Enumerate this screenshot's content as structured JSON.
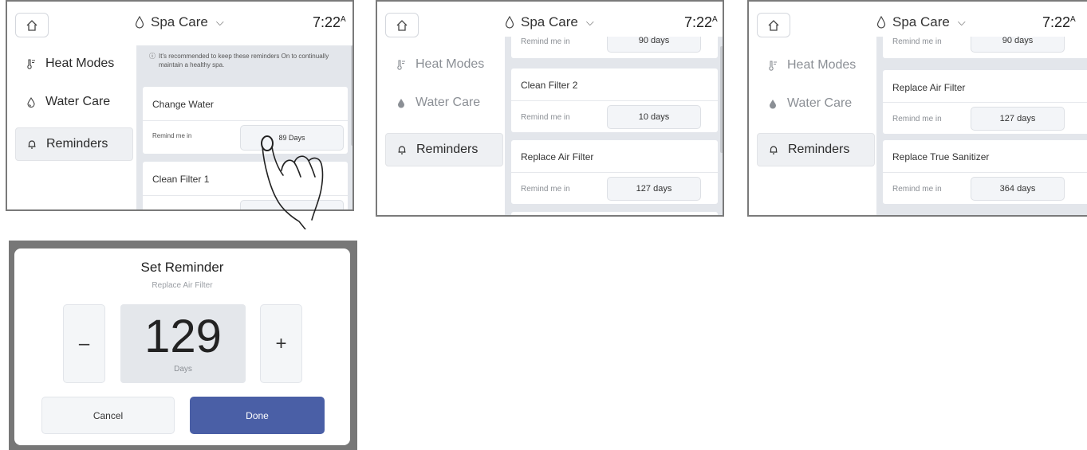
{
  "app": {
    "title": "Spa Care",
    "time": "7:22",
    "time_suffix": "A"
  },
  "nav": {
    "heat_modes": "Heat Modes",
    "water_care": "Water Care",
    "reminders": "Reminders"
  },
  "screen1": {
    "info_text": "It's recommended to keep these reminders On to continually maintain a healthy spa.",
    "cards": [
      {
        "title": "Change Water",
        "remind_label": "Remind me in",
        "value": "89 Days"
      },
      {
        "title": "Clean Filter 1"
      }
    ]
  },
  "screen2": {
    "top_remind_label": "Remind me in",
    "top_value": "90 days",
    "cards": [
      {
        "title": "Clean Filter 2",
        "remind_label": "Remind me in",
        "value": "10 days"
      },
      {
        "title": "Replace Air Filter",
        "remind_label": "Remind me in",
        "value": "127 days"
      }
    ]
  },
  "screen3": {
    "top_remind_label": "Remind me in",
    "top_value": "90 days",
    "cards": [
      {
        "title": "Replace Air Filter",
        "remind_label": "Remind me in",
        "value": "127 days"
      },
      {
        "title": "Replace True Sanitizer",
        "remind_label": "Remind me in",
        "value": "364 days"
      }
    ]
  },
  "dialog": {
    "title": "Set Reminder",
    "subtitle": "Replace Air Filter",
    "minus": "–",
    "plus": "+",
    "value": "129",
    "unit": "Days",
    "cancel": "Cancel",
    "done": "Done"
  },
  "colors": {
    "done_button": "#4a5fa6",
    "content_bg": "#e3e6eb"
  }
}
